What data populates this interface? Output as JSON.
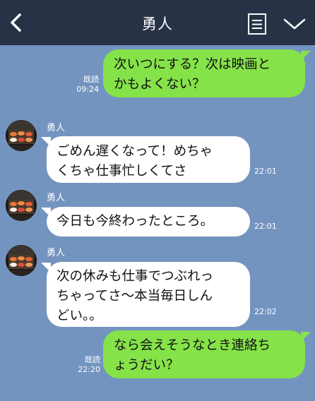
{
  "header": {
    "title": "勇人"
  },
  "messages": [
    {
      "sender": "",
      "text": "次いつにする？次は映画と\nかもよくない？",
      "read_label": "既読",
      "time": "09:24"
    },
    {
      "sender": "勇人",
      "text": "ごめん遅くなって！めちゃ\nくちゃ仕事忙しくてさ",
      "time": "22:01"
    },
    {
      "sender": "勇人",
      "text": "今日も今終わったところ。",
      "time": "22:01"
    },
    {
      "sender": "勇人",
      "text": "次の休みも仕事でつぶれっ\nちゃってさ〜本当毎日しん\nどい。。",
      "time": "22:02"
    },
    {
      "sender": "",
      "text": "なら会えそうなとき連絡ち\nょうだい？",
      "read_label": "既読",
      "time": "22:20"
    }
  ],
  "icons": {
    "back": "chevron-left-icon",
    "menu": "notes-menu-icon",
    "dropdown": "chevron-down-icon",
    "avatar": "sushi-photo-avatar"
  },
  "colors": {
    "header_bg": "#273246",
    "chat_bg": "#7494c0",
    "outgoing_bubble": "#85e249",
    "incoming_bubble": "#ffffff"
  }
}
